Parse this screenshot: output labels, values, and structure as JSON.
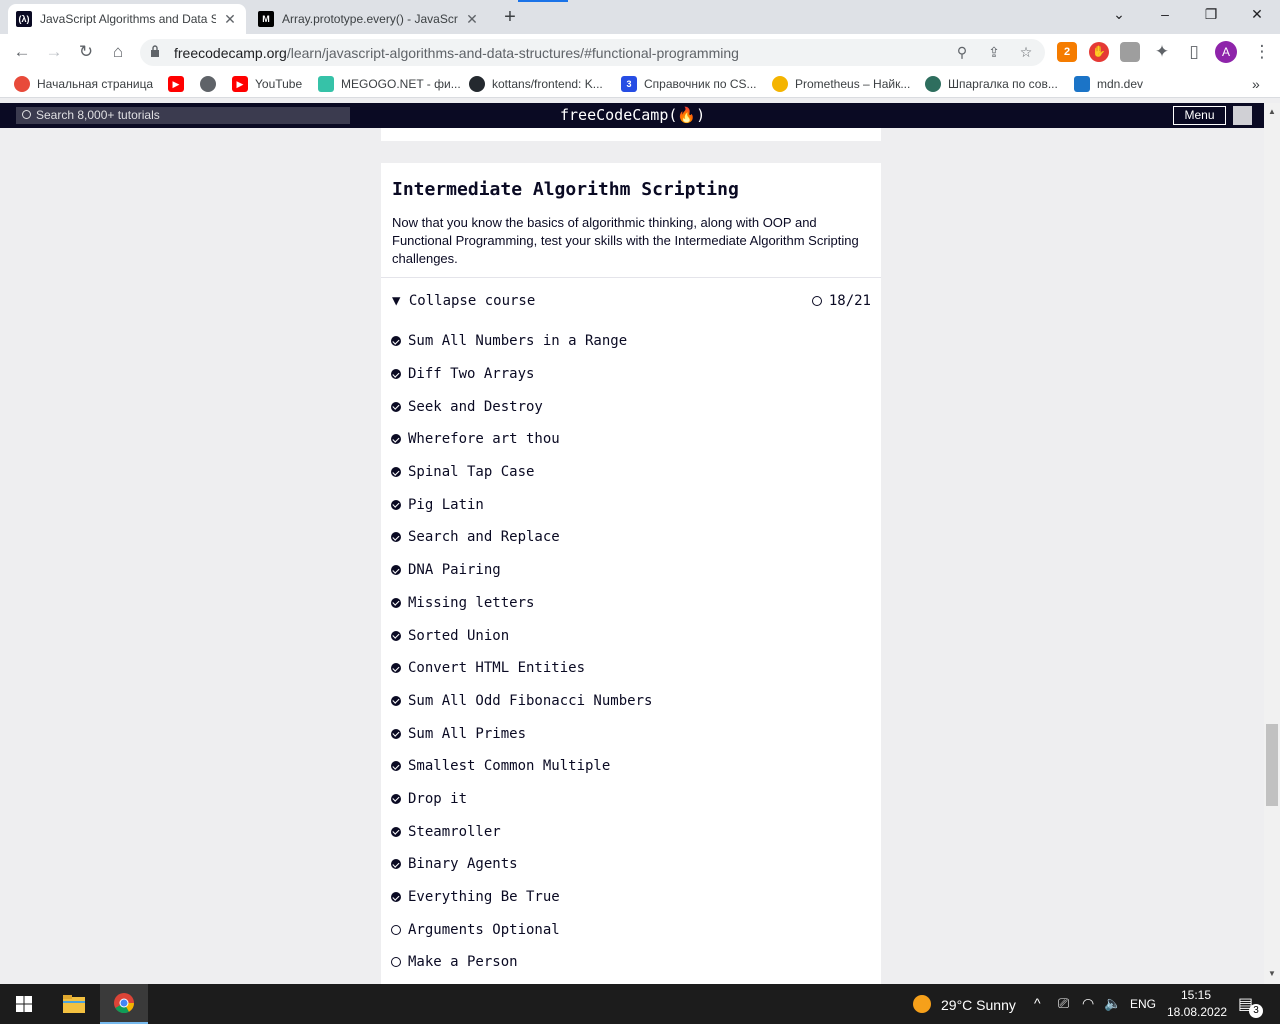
{
  "browser": {
    "tabs": [
      {
        "title": "JavaScript Algorithms and Data S",
        "favicon": "(λ)",
        "active": true
      },
      {
        "title": "Array.prototype.every() - JavaScri",
        "favicon": "M",
        "active": false
      }
    ],
    "new_tab": "+",
    "url_host": "freecodecamp.org",
    "url_path": "/learn/javascript-algorithms-and-data-structures/#functional-programming",
    "profile_initial": "A",
    "ext_badge": "2"
  },
  "bookmarks": [
    {
      "label": "Начальная страница",
      "color": "#e84a3a"
    },
    {
      "label": "",
      "color": "#ff0000"
    },
    {
      "label": "",
      "color": "#5f6368"
    },
    {
      "label": "YouTube",
      "color": "#ff0000"
    },
    {
      "label": "MEGOGO.NET - фи...",
      "color": "#36c2a8"
    },
    {
      "label": "kottans/frontend: K...",
      "color": "#24292f"
    },
    {
      "label": "Справочник по CS...",
      "color": "#264de4"
    },
    {
      "label": "Prometheus – Найк...",
      "color": "#f4b400"
    },
    {
      "label": "Шпаргалка по сов...",
      "color": "#2e6e5e"
    },
    {
      "label": "mdn.dev",
      "color": "#1b74c7"
    }
  ],
  "fcc": {
    "search_placeholder": "Search 8,000+ tutorials",
    "logo": "freeCodeCamp(🔥)",
    "menu_label": "Menu"
  },
  "course": {
    "title": "Intermediate Algorithm Scripting",
    "description": "Now that you know the basics of algorithmic thinking, along with OOP and Functional Programming, test your skills with the Intermediate Algorithm Scripting challenges.",
    "collapse_label": "▼ Collapse course",
    "progress": "18/21",
    "challenges": [
      {
        "name": "Sum All Numbers in a Range",
        "done": true
      },
      {
        "name": "Diff Two Arrays",
        "done": true
      },
      {
        "name": "Seek and Destroy",
        "done": true
      },
      {
        "name": "Wherefore art thou",
        "done": true
      },
      {
        "name": "Spinal Tap Case",
        "done": true
      },
      {
        "name": "Pig Latin",
        "done": true
      },
      {
        "name": "Search and Replace",
        "done": true
      },
      {
        "name": "DNA Pairing",
        "done": true
      },
      {
        "name": "Missing letters",
        "done": true
      },
      {
        "name": "Sorted Union",
        "done": true
      },
      {
        "name": "Convert HTML Entities",
        "done": true
      },
      {
        "name": "Sum All Odd Fibonacci Numbers",
        "done": true
      },
      {
        "name": "Sum All Primes",
        "done": true
      },
      {
        "name": "Smallest Common Multiple",
        "done": true
      },
      {
        "name": "Drop it",
        "done": true
      },
      {
        "name": "Steamroller",
        "done": true
      },
      {
        "name": "Binary Agents",
        "done": true
      },
      {
        "name": "Everything Be True",
        "done": true
      },
      {
        "name": "Arguments Optional",
        "done": false
      },
      {
        "name": "Make a Person",
        "done": false
      }
    ]
  },
  "taskbar": {
    "weather": "29°C  Sunny",
    "lang": "ENG",
    "time": "15:15",
    "date": "18.08.2022",
    "notifications": "3"
  }
}
